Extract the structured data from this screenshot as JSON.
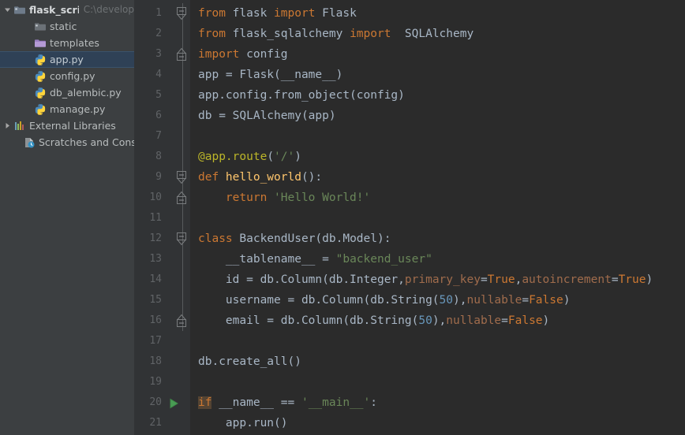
{
  "sidebar": {
    "items": [
      {
        "label": "flask_script",
        "path": "C:\\develop",
        "icon": "folder-module-icon",
        "twisty": "expanded",
        "indent": 0,
        "bold": true,
        "selected": false
      },
      {
        "label": "static",
        "path": "",
        "icon": "folder-plain-icon",
        "twisty": "none",
        "indent": 2,
        "bold": false,
        "selected": false
      },
      {
        "label": "templates",
        "path": "",
        "icon": "folder-purple-icon",
        "twisty": "none",
        "indent": 2,
        "bold": false,
        "selected": false
      },
      {
        "label": "app.py",
        "path": "",
        "icon": "python-file-icon",
        "twisty": "none",
        "indent": 2,
        "bold": false,
        "selected": true
      },
      {
        "label": "config.py",
        "path": "",
        "icon": "python-file-icon",
        "twisty": "none",
        "indent": 2,
        "bold": false,
        "selected": false
      },
      {
        "label": "db_alembic.py",
        "path": "",
        "icon": "python-file-icon",
        "twisty": "none",
        "indent": 2,
        "bold": false,
        "selected": false
      },
      {
        "label": "manage.py",
        "path": "",
        "icon": "python-file-icon",
        "twisty": "none",
        "indent": 2,
        "bold": false,
        "selected": false
      },
      {
        "label": "External Libraries",
        "path": "",
        "icon": "library-icon",
        "twisty": "collapsed",
        "indent": 0,
        "bold": false,
        "selected": false
      },
      {
        "label": "Scratches and Console",
        "path": "",
        "icon": "scratches-icon",
        "twisty": "none",
        "indent": 1,
        "bold": false,
        "selected": false
      }
    ]
  },
  "editor": {
    "line_numbers": [
      "1",
      "2",
      "3",
      "4",
      "5",
      "6",
      "7",
      "8",
      "9",
      "10",
      "11",
      "12",
      "13",
      "14",
      "15",
      "16",
      "17",
      "18",
      "19",
      "20",
      "21"
    ],
    "fold_markers": [
      {
        "line": 1,
        "type": "fold-open-start"
      },
      {
        "line": 2,
        "type": "line"
      },
      {
        "line": 3,
        "type": "fold-end"
      },
      {
        "line": 4,
        "type": "none"
      },
      {
        "line": 5,
        "type": "none"
      },
      {
        "line": 6,
        "type": "none"
      },
      {
        "line": 7,
        "type": "none"
      },
      {
        "line": 8,
        "type": "none"
      },
      {
        "line": 9,
        "type": "fold-open-start"
      },
      {
        "line": 10,
        "type": "fold-end"
      },
      {
        "line": 11,
        "type": "none"
      },
      {
        "line": 12,
        "type": "fold-open-start"
      },
      {
        "line": 13,
        "type": "line"
      },
      {
        "line": 14,
        "type": "line"
      },
      {
        "line": 15,
        "type": "line"
      },
      {
        "line": 16,
        "type": "fold-end"
      },
      {
        "line": 17,
        "type": "none"
      },
      {
        "line": 18,
        "type": "none"
      },
      {
        "line": 19,
        "type": "none"
      },
      {
        "line": 20,
        "type": "run-arrow"
      },
      {
        "line": 21,
        "type": "none"
      }
    ],
    "run_arrow_line": 20,
    "code_lines": [
      [
        {
          "t": "from ",
          "c": "kw"
        },
        {
          "t": "flask ",
          "c": "plain"
        },
        {
          "t": "import ",
          "c": "kw"
        },
        {
          "t": "Flask",
          "c": "plain"
        }
      ],
      [
        {
          "t": "from ",
          "c": "kw"
        },
        {
          "t": "flask_sqlalchemy ",
          "c": "plain"
        },
        {
          "t": "import ",
          "c": "kw"
        },
        {
          "t": " SQLAlchemy",
          "c": "plain"
        }
      ],
      [
        {
          "t": "import ",
          "c": "kw"
        },
        {
          "t": "config",
          "c": "plain"
        }
      ],
      [
        {
          "t": "app = Flask(__name__)",
          "c": "plain"
        }
      ],
      [
        {
          "t": "app.config.from_object(config)",
          "c": "plain"
        }
      ],
      [
        {
          "t": "db = SQLAlchemy(app)",
          "c": "plain"
        }
      ],
      [],
      [
        {
          "t": "@app.route",
          "c": "deco"
        },
        {
          "t": "(",
          "c": "plain"
        },
        {
          "t": "'/'",
          "c": "str"
        },
        {
          "t": ")",
          "c": "plain"
        }
      ],
      [
        {
          "t": "def ",
          "c": "kw"
        },
        {
          "t": "hello_world",
          "c": "fn"
        },
        {
          "t": "():",
          "c": "plain"
        }
      ],
      [
        {
          "t": "    ",
          "c": "plain"
        },
        {
          "t": "return ",
          "c": "kw"
        },
        {
          "t": "'Hello World!'",
          "c": "str"
        }
      ],
      [],
      [
        {
          "t": "class ",
          "c": "kw"
        },
        {
          "t": "BackendUser",
          "c": "cls"
        },
        {
          "t": "(db.Model):",
          "c": "plain"
        }
      ],
      [
        {
          "t": "    __tablename__ = ",
          "c": "plain"
        },
        {
          "t": "\"backend_user\"",
          "c": "str"
        }
      ],
      [
        {
          "t": "    id = db.Column(db.Integer,",
          "c": "plain"
        },
        {
          "t": "primary_key",
          "c": "kwarg"
        },
        {
          "t": "=",
          "c": "plain"
        },
        {
          "t": "True",
          "c": "kw"
        },
        {
          "t": ",",
          "c": "plain"
        },
        {
          "t": "autoincrement",
          "c": "kwarg"
        },
        {
          "t": "=",
          "c": "plain"
        },
        {
          "t": "True",
          "c": "kw"
        },
        {
          "t": ")",
          "c": "plain"
        }
      ],
      [
        {
          "t": "    username = db.Column(db.String(",
          "c": "plain"
        },
        {
          "t": "50",
          "c": "num"
        },
        {
          "t": "),",
          "c": "plain"
        },
        {
          "t": "nullable",
          "c": "kwarg"
        },
        {
          "t": "=",
          "c": "plain"
        },
        {
          "t": "False",
          "c": "kw"
        },
        {
          "t": ")",
          "c": "plain"
        }
      ],
      [
        {
          "t": "    email = db.Column(db.String(",
          "c": "plain"
        },
        {
          "t": "50",
          "c": "num"
        },
        {
          "t": "),",
          "c": "plain"
        },
        {
          "t": "nullable",
          "c": "kwarg"
        },
        {
          "t": "=",
          "c": "plain"
        },
        {
          "t": "False",
          "c": "kw"
        },
        {
          "t": ")",
          "c": "plain"
        }
      ],
      [],
      [
        {
          "t": "db.create_all()",
          "c": "plain"
        }
      ],
      [],
      [
        {
          "t": "if",
          "c": "hl"
        },
        {
          "t": " __name__ == ",
          "c": "plain"
        },
        {
          "t": "'__main__'",
          "c": "str"
        },
        {
          "t": ":",
          "c": "plain"
        }
      ],
      [
        {
          "t": "    app.run()",
          "c": "plain"
        }
      ]
    ]
  },
  "colors": {
    "editor_background": "#2b2b2b",
    "gutter_background": "#313335",
    "sidebar_background": "#3c3f41",
    "selection_background": "#2f4156",
    "keyword": "#cc7832",
    "string": "#6a8759",
    "function": "#ffc66d",
    "decorator": "#bbb529",
    "number": "#6897bb",
    "kwarg": "#a06c4c",
    "default_text": "#a9b7c6",
    "run_arrow": "#499c54"
  }
}
